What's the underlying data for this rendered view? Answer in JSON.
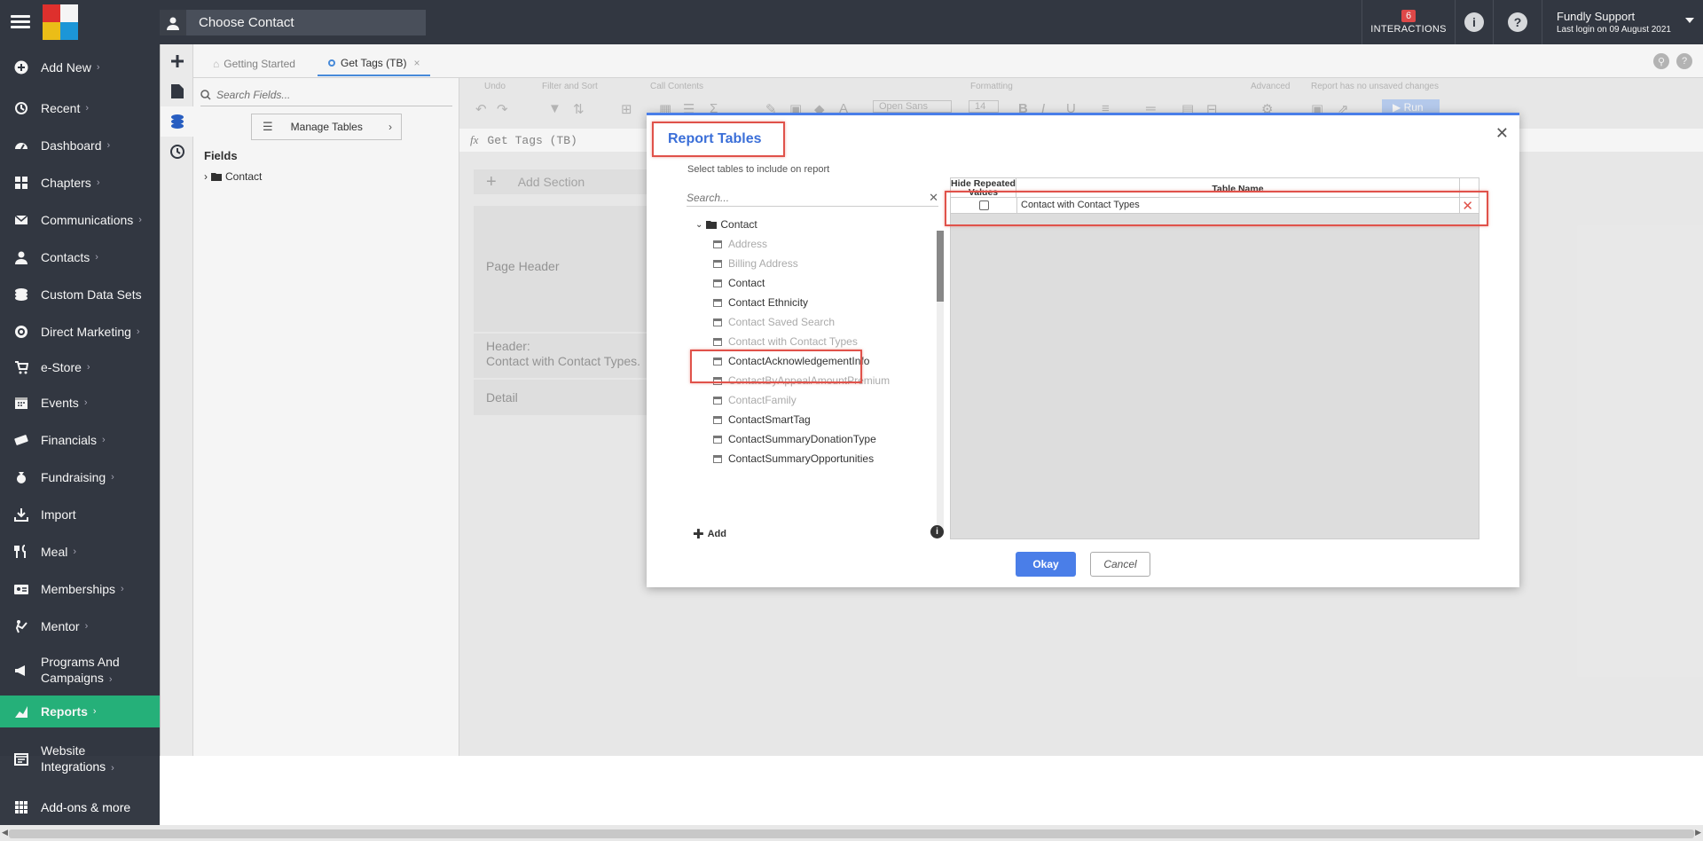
{
  "topbar": {
    "contact_label": "Choose Contact",
    "interactions_count": "6",
    "interactions_label": "INTERACTIONS",
    "user_name": "Fundly Support",
    "last_login": "Last login on 09 August 2021"
  },
  "sidebar": {
    "items": [
      {
        "label": "Add New",
        "icon": "plus-circle-icon"
      },
      {
        "label": "Recent",
        "icon": "history-icon"
      },
      {
        "label": "Dashboard",
        "icon": "gauge-icon"
      },
      {
        "label": "Chapters",
        "icon": "grid-icon"
      },
      {
        "label": "Communications",
        "icon": "envelope-icon"
      },
      {
        "label": "Contacts",
        "icon": "person-icon"
      },
      {
        "label": "Custom Data Sets",
        "icon": "layers-icon"
      },
      {
        "label": "Direct Marketing",
        "icon": "target-icon"
      },
      {
        "label": "e-Store",
        "icon": "cart-icon"
      },
      {
        "label": "Events",
        "icon": "calendar-icon"
      },
      {
        "label": "Financials",
        "icon": "money-icon"
      },
      {
        "label": "Fundraising",
        "icon": "moneybag-icon"
      },
      {
        "label": "Import",
        "icon": "import-icon"
      },
      {
        "label": "Meal",
        "icon": "utensils-icon"
      },
      {
        "label": "Memberships",
        "icon": "id-card-icon"
      },
      {
        "label": "Mentor",
        "icon": "mentor-icon"
      },
      {
        "label": "Programs And",
        "label2": "Campaigns",
        "icon": "megaphone-icon"
      },
      {
        "label": "Reports",
        "icon": "chart-icon"
      },
      {
        "label": "Website",
        "label2": "Integrations",
        "icon": "browser-icon"
      },
      {
        "label": "Add-ons & more",
        "icon": "apps-icon"
      }
    ]
  },
  "tabs": {
    "getting_started": "Getting Started",
    "get_tags": "Get Tags (TB)"
  },
  "fields_panel": {
    "search_placeholder": "Search Fields...",
    "manage_tables": "Manage Tables",
    "heading": "Fields",
    "tree_root": "Contact"
  },
  "ribbon": {
    "undo": "Undo",
    "filter_sort": "Filter and Sort",
    "call_contents": "Call Contents",
    "formatting": "Formatting",
    "advanced": "Advanced",
    "status": "Report has no unsaved changes",
    "font": "Open Sans",
    "size": "14",
    "run": "Run"
  },
  "report": {
    "fx_text": "Get Tags (TB)",
    "add_section": "Add Section",
    "page_header": "Page Header",
    "header_line1": "Header:",
    "header_line2": "Contact with Contact Types.",
    "detail": "Detail"
  },
  "modal": {
    "title": "Report Tables",
    "subtitle": "Select tables to include on report",
    "search_placeholder": "Search...",
    "root": "Contact",
    "tables": [
      {
        "name": "Address",
        "enabled": false
      },
      {
        "name": "Billing Address",
        "enabled": false
      },
      {
        "name": "Contact",
        "enabled": true
      },
      {
        "name": "Contact Ethnicity",
        "enabled": true
      },
      {
        "name": "Contact Saved Search",
        "enabled": false
      },
      {
        "name": "Contact with Contact Types",
        "enabled": false
      },
      {
        "name": "ContactAcknowledgementInfo",
        "enabled": true
      },
      {
        "name": "ContactByAppealAmountPremium",
        "enabled": false
      },
      {
        "name": "ContactFamily",
        "enabled": false
      },
      {
        "name": "ContactSmartTag",
        "enabled": true
      },
      {
        "name": "ContactSummaryDonationType",
        "enabled": true
      },
      {
        "name": "ContactSummaryOpportunities",
        "enabled": true
      }
    ],
    "add_label": "Add",
    "grid": {
      "col_hide": "Hide Repeated Values",
      "col_name": "Table Name",
      "rows": [
        {
          "hide_repeated": false,
          "table_name": "Contact with Contact Types"
        }
      ]
    },
    "okay": "Okay",
    "cancel": "Cancel"
  },
  "colors": {
    "sidebar_bg": "#353a44",
    "active_green": "#27b87e",
    "accent_blue": "#4a7ee8",
    "highlight_red": "#e0524a"
  }
}
